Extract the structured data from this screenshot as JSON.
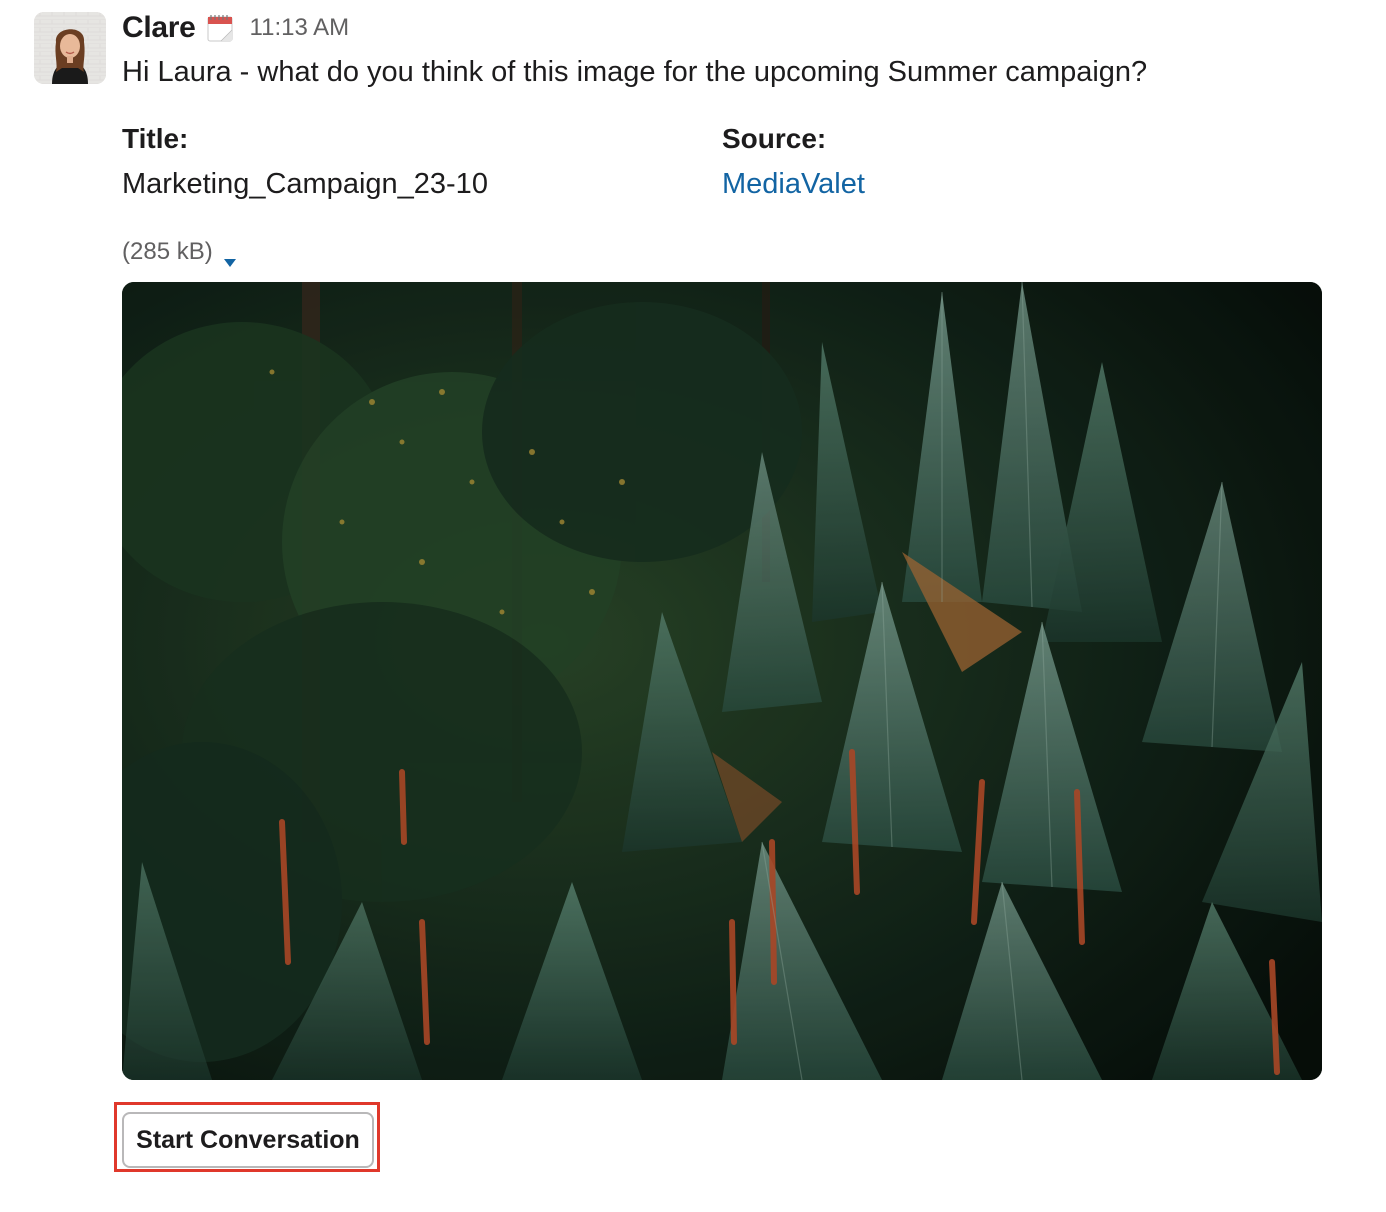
{
  "message": {
    "sender": "Clare",
    "status_icon": "calendar-icon",
    "timestamp": "11:13 AM",
    "text": "Hi Laura - what do you think of this image for the upcoming Summer campaign?"
  },
  "fields": {
    "title_label": "Title:",
    "title_value": "Marketing_Campaign_23-10",
    "source_label": "Source:",
    "source_value": "MediaValet"
  },
  "file": {
    "size": "(285 kB)",
    "toggle_icon": "caret-down-icon"
  },
  "action": {
    "button_label": "Start Conversation"
  },
  "colors": {
    "link": "#1264a3",
    "highlight": "#e0382b",
    "text": "#1d1c1d",
    "muted": "#616061"
  }
}
